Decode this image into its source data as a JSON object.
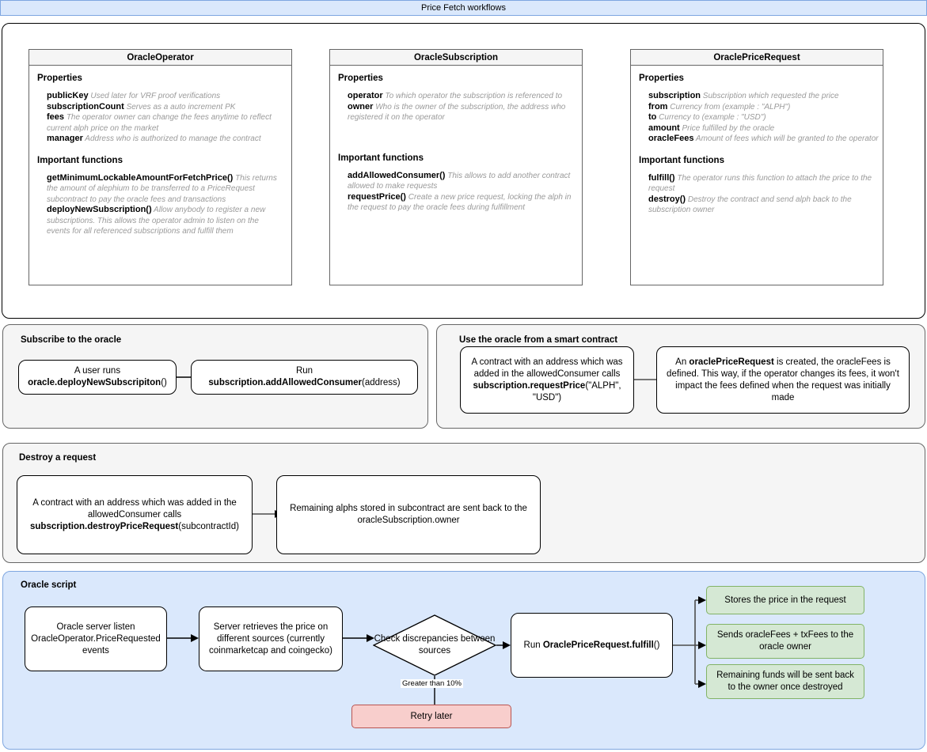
{
  "titlebar": {
    "title": "Price Fetch workflows"
  },
  "colors": {
    "header_bg": "#dae8fc",
    "header_border": "#7ea6e0",
    "panel_gray": "#f5f5f5",
    "green_fill": "#d5e8d4",
    "green_border": "#82b366",
    "pink_fill": "#f8cecc",
    "pink_border": "#b85450",
    "card_head": "#f5f5f5"
  },
  "contracts": {
    "section_labels": {
      "properties": "Properties",
      "functions": "Important functions"
    },
    "cards": [
      {
        "name": "OracleOperator",
        "properties": [
          {
            "name": "publicKey",
            "desc": "Used later for VRF proof verifications"
          },
          {
            "name": "subscriptionCount",
            "desc": "Serves as a auto increment PK"
          },
          {
            "name": "fees",
            "desc": "The operator owner can change the fees anytime to reflect current alph price on the market"
          },
          {
            "name": "manager",
            "desc": "Address who is authorized to manage the contract"
          }
        ],
        "functions": [
          {
            "name": "getMinimumLockableAmountForFetchPrice()",
            "desc": "This returns the amount of alephium to be transferred to a PriceRequest subcontract to pay the oracle fees and transactions"
          },
          {
            "name": "deployNewSubscription()",
            "desc": "Allow anybody to register a new subscriptions. This allows the operator admin to listen on the events for all referenced subscriptions and fulfill them"
          }
        ]
      },
      {
        "name": "OracleSubscription",
        "properties": [
          {
            "name": "operator",
            "desc": "To which operator the subscription is referenced to"
          },
          {
            "name": "owner",
            "desc": "Who is the owner of the subscription, the address who registered it on the operator"
          }
        ],
        "functions": [
          {
            "name": "addAllowedConsumer()",
            "desc": "This allows to add another contract allowed to make requests"
          },
          {
            "name": "requestPrice()",
            "desc": "Create a new price request, locking the alph in the request to pay the oracle fees during fulfillment"
          }
        ]
      },
      {
        "name": "OraclePriceRequest",
        "properties": [
          {
            "name": "subscription",
            "desc": "Subscription which requested the price"
          },
          {
            "name": "from",
            "desc": "Currency from (example : \"ALPH\")"
          },
          {
            "name": "to",
            "desc": "Currency to (example : \"USD\")"
          },
          {
            "name": "amount",
            "desc": "Price fulfilled by the oracle"
          },
          {
            "name": "oracleFees",
            "desc": "Amount of fees which will be granted to the operator"
          }
        ],
        "functions": [
          {
            "name": "fulfill()",
            "desc": "The operator runs this function to attach the price to the request"
          },
          {
            "name": "destroy()",
            "desc": "Destroy the contract and send alph back to the subscription owner"
          }
        ]
      }
    ]
  },
  "subscribe_flow": {
    "title": "Subscribe to the oracle",
    "nodes": [
      {
        "line1": "A user runs",
        "bold": "oracle.deployNewSubscripiton",
        "tail": "()"
      },
      {
        "line1": "Run",
        "bold": "subscription.addAllowedConsumer",
        "tail": "(address)"
      }
    ]
  },
  "smart_contract_flow": {
    "title": "Use the oracle from a smart contract",
    "node1": {
      "line1": "A contract with an address which was",
      "line2": "added in the allowedConsumer calls",
      "bold": "subscription.requestPrice",
      "tail": "(\"ALPH\", \"USD\")"
    },
    "node2": {
      "pre": "An ",
      "bold": "oraclePriceRequest",
      "post": " is created, the oracleFees is defined. This way, if the operator changes its fees, it won't impact the fees defined when the request was initially made"
    }
  },
  "destroy_flow": {
    "title": "Destroy a request",
    "node1": {
      "line1": "A contract with an address which was added in the allowedConsumer calls",
      "bold": "subscription.destroyPriceRequest",
      "tail": "(subcontractId)"
    },
    "node2": "Remaining alphs stored in subcontract are sent back to the oracleSubscription.owner"
  },
  "oracle_script": {
    "title": "Oracle script",
    "step1": "Oracle server listen OracleOperator.PriceRequested events",
    "step2": "Server retrieves the price on different sources (currently coinmarketcap and coingecko)",
    "decision": "Check discrepancies between sources",
    "edge_label": "Greater than 10%",
    "retry": "Retry later",
    "fulfill": {
      "pre": "Run ",
      "bold": "OraclePriceRequest.fulfill",
      "post": "()"
    },
    "outcomes": [
      "Stores the price in the request",
      "Sends oracleFees + txFees to the oracle owner",
      "Remaining funds will be sent back to the owner once destroyed"
    ]
  }
}
